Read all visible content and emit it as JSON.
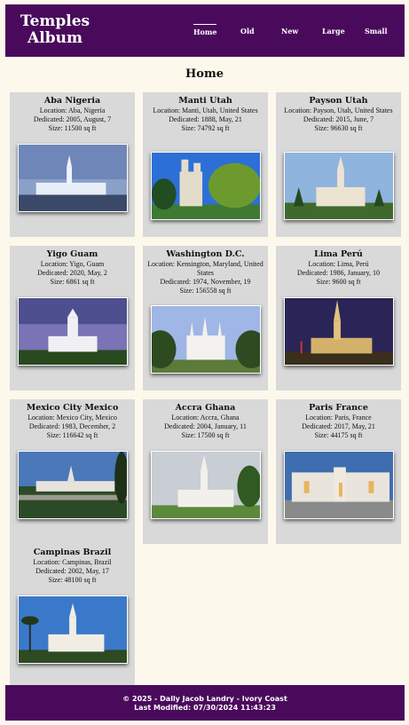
{
  "header": {
    "brand_line1": "Temples",
    "brand_line2": "Album",
    "nav": [
      "Home",
      "Old",
      "New",
      "Large",
      "Small"
    ],
    "active_nav": "Home"
  },
  "page": {
    "title": "Home"
  },
  "temples": [
    {
      "name": "Aba Nigeria",
      "location": "Location: Aba, Nigeria",
      "dedicated": "Dedicated: 2005, August, 7",
      "size": "Size: 11500 sq ft"
    },
    {
      "name": "Manti Utah",
      "location": "Location: Manti, Utah, United States",
      "dedicated": "Dedicated: 1888, May, 21",
      "size": "Size: 74792 sq ft"
    },
    {
      "name": "Payson Utah",
      "location": "Location: Payson, Utah, United States",
      "dedicated": "Dedicated: 2015, June, 7",
      "size": "Size: 96630 sq ft"
    },
    {
      "name": "Yigo Guam",
      "location": "Location: Yigo, Guam",
      "dedicated": "Dedicated: 2020, May, 2",
      "size": "Size: 6861 sq ft"
    },
    {
      "name": "Washington D.C.",
      "location": "Location: Kensington, Maryland, United States",
      "dedicated": "Dedicated: 1974, November, 19",
      "size": "Size: 156558 sq ft"
    },
    {
      "name": "Lima Perú",
      "location": "Location: Lima, Perú",
      "dedicated": "Dedicated: 1986, January, 10",
      "size": "Size: 9600 sq ft"
    },
    {
      "name": "Mexico City Mexico",
      "location": "Location: Mexico City, Mexico",
      "dedicated": "Dedicated: 1983, December, 2",
      "size": "Size: 116642 sq ft"
    },
    {
      "name": "Accra Ghana",
      "location": "Location: Accra, Ghana",
      "dedicated": "Dedicated: 2004, January, 11",
      "size": "Size: 17500 sq ft"
    },
    {
      "name": "Paris France",
      "location": "Location: Paris, France",
      "dedicated": "Dedicated: 2017, May, 21",
      "size": "Size: 44175 sq ft"
    },
    {
      "name": "Campinas Brazil",
      "location": "Location: Campinas, Brazil",
      "dedicated": "Dedicated: 2002, May, 17",
      "size": "Size: 48100 sq ft"
    }
  ],
  "footer": {
    "copyright": "© 2025 - Dally Jacob Landry - Ivory Coast",
    "last_modified": "Last Modified: 07/30/2024 11:43:23"
  },
  "colors": {
    "header_bg": "#4a0a5c",
    "page_bg": "#fdf8ec",
    "card_bg": "#d9d9d9"
  }
}
